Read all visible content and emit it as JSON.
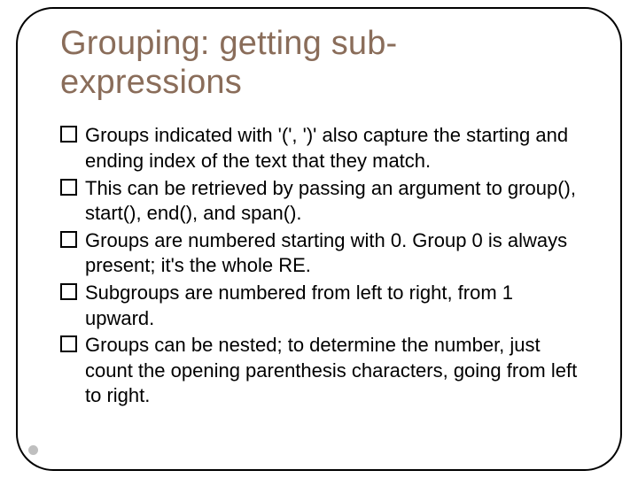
{
  "slide": {
    "title": "Grouping: getting sub-expressions",
    "bullets": [
      "Groups indicated with '(', ')' also capture the starting and ending index of the text that they match.",
      "This can be retrieved by passing an argument to group(), start(), end(), and span().",
      "Groups are numbered starting with 0. Group 0 is always present; it's the whole RE.",
      "Subgroups are numbered from left to right, from 1 upward.",
      "Groups can be nested; to determine the number, just count the opening parenthesis characters, going from left to right."
    ]
  }
}
